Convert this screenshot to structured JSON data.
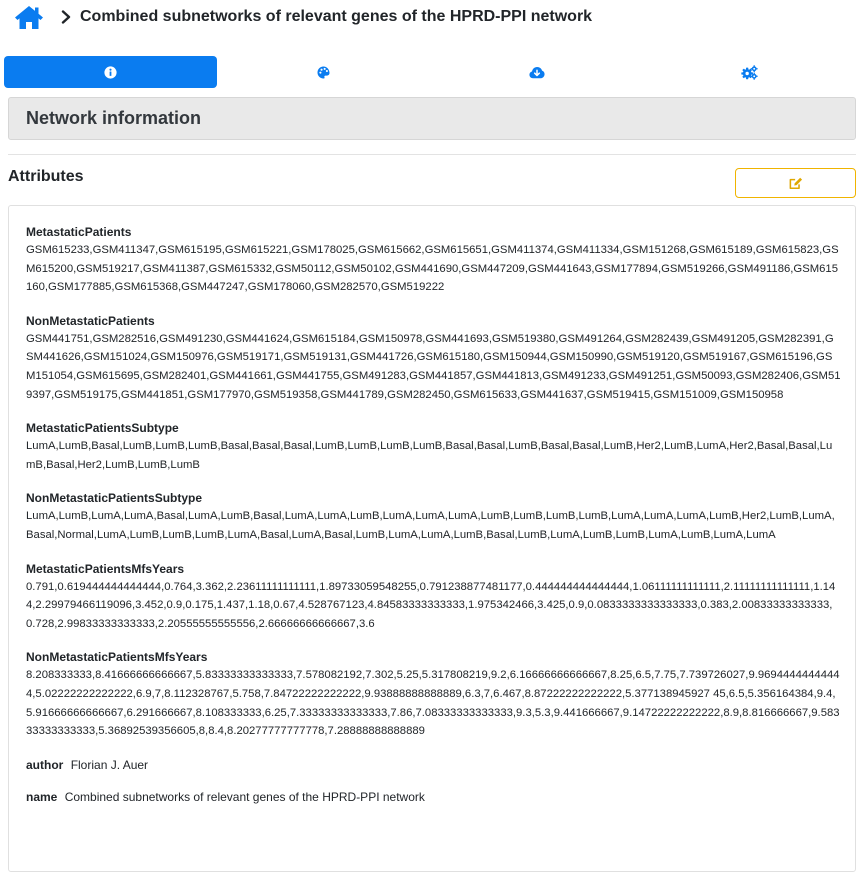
{
  "header": {
    "title": "Combined subnetworks of relevant genes of the HPRD-PPI network"
  },
  "tabs": [
    {
      "icon": "info-icon",
      "active": true
    },
    {
      "icon": "palette-icon",
      "active": false
    },
    {
      "icon": "cloud-download-icon",
      "active": false
    },
    {
      "icon": "cogs-icon",
      "active": false
    }
  ],
  "section": {
    "title": "Network information"
  },
  "attributes_label": "Attributes",
  "colors": {
    "accent": "#0a7cf0",
    "edit_border": "#f0b400",
    "edit_icon": "#e0a800"
  },
  "attributes": [
    {
      "key": "MetastaticPatients",
      "value": "GSM615233,GSM411347,GSM615195,GSM615221,GSM178025,GSM615662,GSM615651,GSM411374,GSM411334,GSM151268,GSM615189,GSM615823,GSM615200,GSM519217,GSM411387,GSM615332,GSM50112,GSM50102,GSM441690,GSM447209,GSM441643,GSM177894,GSM519266,GSM491186,GSM615160,GSM177885,GSM615368,GSM447247,GSM178060,GSM282570,GSM519222"
    },
    {
      "key": "NonMetastaticPatients",
      "value": "GSM441751,GSM282516,GSM491230,GSM441624,GSM615184,GSM150978,GSM441693,GSM519380,GSM491264,GSM282439,GSM491205,GSM282391,GSM441626,GSM151024,GSM150976,GSM519171,GSM519131,GSM441726,GSM615180,GSM150944,GSM150990,GSM519120,GSM519167,GSM615196,GSM151054,GSM615695,GSM282401,GSM441661,GSM441755,GSM491283,GSM441857,GSM441813,GSM491233,GSM491251,GSM50093,GSM282406,GSM519397,GSM519175,GSM441851,GSM177970,GSM519358,GSM441789,GSM282450,GSM615633,GSM441637,GSM519415,GSM151009,GSM150958"
    },
    {
      "key": "MetastaticPatientsSubtype",
      "value": "LumA,LumB,Basal,LumB,LumB,LumB,Basal,Basal,Basal,LumB,LumB,LumB,LumB,Basal,Basal,LumB,Basal,Basal,LumB,Her2,LumB,LumA,Her2,Basal,Basal,LumB,Basal,Her2,LumB,LumB,LumB"
    },
    {
      "key": "NonMetastaticPatientsSubtype",
      "value": "LumA,LumB,LumA,LumA,Basal,LumA,LumB,Basal,LumA,LumA,LumB,LumA,LumA,LumA,LumB,LumB,LumB,LumB,LumA,LumA,LumA,LumB,Her2,LumB,LumA,Basal,Normal,LumA,LumB,LumB,LumB,LumA,Basal,LumA,Basal,LumB,LumA,LumA,LumB,Basal,LumB,LumA,LumB,LumB,LumA,LumB,LumA,LumA"
    },
    {
      "key": "MetastaticPatientsMfsYears",
      "value": "0.791,0.619444444444444,0.764,3.362,2.23611111111111,1.89733059548255,0.791238877481177,0.444444444444444,1.06111111111111,2.11111111111111,1.144,2.29979466119096,3.452,0.9,0.175,1.437,1.18,0.67,4.528767123,4.84583333333333,1.975342466,3.425,0.9,0.0833333333333333,0.383,2.00833333333333,0.728,2.99833333333333,2.20555555555556,2.66666666666667,3.6"
    },
    {
      "key": "NonMetastaticPatientsMfsYears",
      "value": "8.208333333,8.41666666666667,5.83333333333333,7.578082192,7.302,5.25,5.317808219,9.2,6.16666666666667,8.25,6.5,7.75,7.739726027,9.96944444444444,5.02222222222222,6.9,7,8.112328767,5.758,7.84722222222222,9.93888888888889,6.3,7,6.467,8.87222222222222,5.377138945927 45,6.5,5.356164384,9.4,5.91666666666667,6.291666667,8.108333333,6.25,7.33333333333333,7.86,7.08333333333333,9.3,5.3,9.441666667,9.14722222222222,8.9,8.816666667,9.58333333333333,5.36892539356605,8,8.4,8.20277777777778,7.28888888888889"
    }
  ],
  "inline_attributes": [
    {
      "key": "author",
      "value": "Florian J. Auer"
    },
    {
      "key": "name",
      "value": "Combined subnetworks of relevant genes of the HPRD-PPI network"
    }
  ]
}
